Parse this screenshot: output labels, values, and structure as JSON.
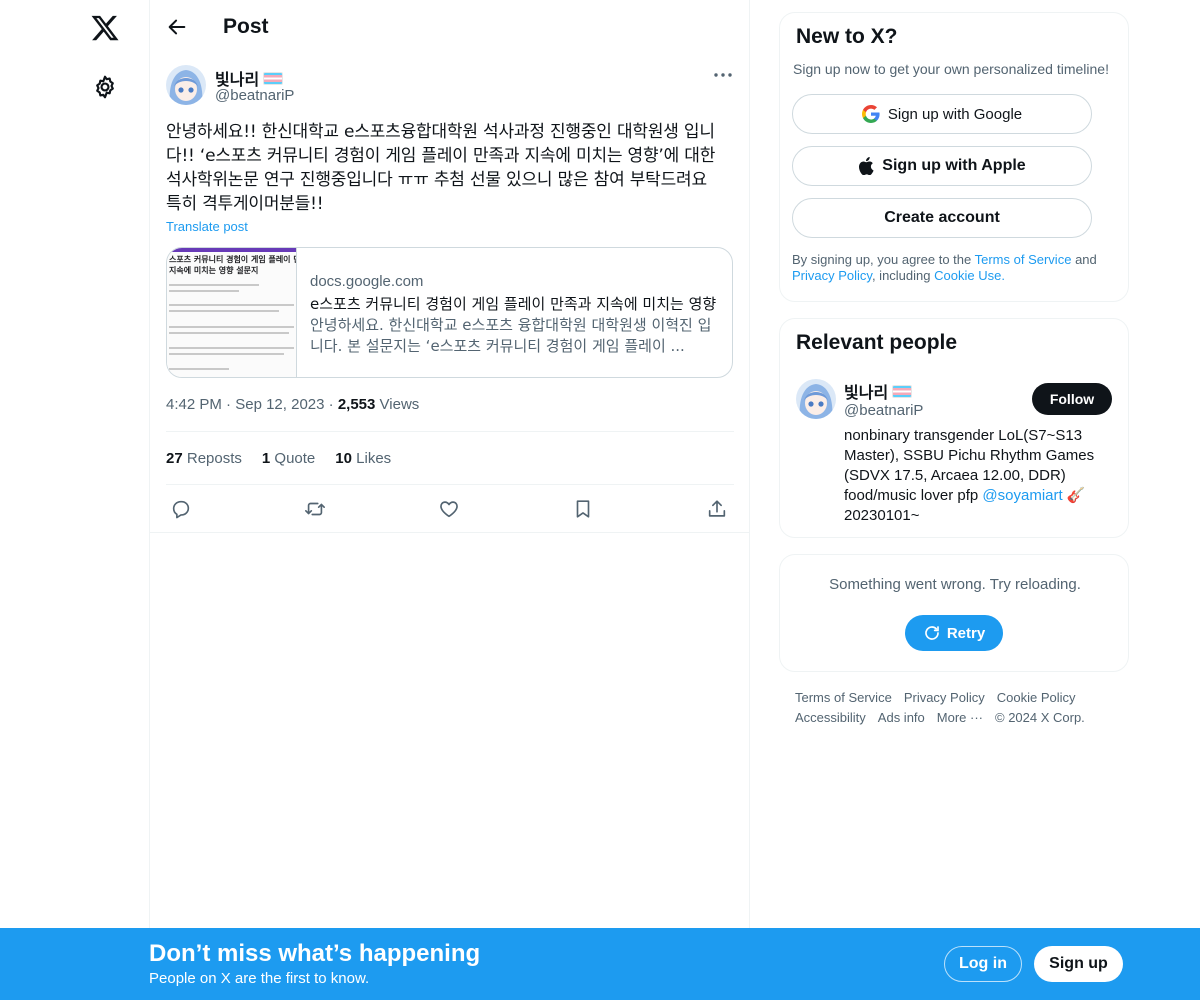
{
  "icons": {
    "logo": "x-logo-icon",
    "settings": "gear-icon",
    "back": "back-arrow-icon",
    "more": "more-horizontal-icon",
    "reply": "reply-icon",
    "repost": "repost-icon",
    "like": "heart-icon",
    "bookmark": "bookmark-icon",
    "share": "share-icon",
    "google": "google-icon",
    "apple": "apple-icon",
    "retry": "refresh-icon"
  },
  "colors": {
    "accent": "#1d9bf0",
    "text": "#0f1419",
    "muted": "#536471",
    "border": "#eff3f4"
  },
  "header": {
    "title": "Post"
  },
  "post": {
    "author_name": "빛나리",
    "author_handle": "@beatnariP",
    "text": "안녕하세요!! 한신대학교 e스포츠융합대학원 석사과정 진행중인 대학원생 입니다!! ‘e스포츠 커뮤니티 경험이 게임 플레이 만족과 지속에 미치는 영향’에 대한 석사학위논문 연구 진행중입니다 ㅠㅠ 추첨 선물 있으니 많은 참여 부탁드려요 특히 격투게이머분들!!",
    "translate_label": "Translate post",
    "card": {
      "thumb_title": "스포츠 커뮤니티 경험이 게임 플레이 만과 지속에 미치는 영향 설문지",
      "domain": "docs.google.com",
      "title": "e스포츠 커뮤니티 경험이 게임 플레이 만족과 지속에 미치는 영향",
      "description": "안녕하세요. 한신대학교 e스포츠 융합대학원 대학원생 이혁진 입니다. 본 설문지는 ‘e스포츠 커뮤니티 경험이 게임 플레이 ..."
    },
    "time": "4:42 PM",
    "date": "Sep 12, 2023",
    "views_count": "2,553",
    "views_label": "Views",
    "reposts_count": "27",
    "reposts_label": "Reposts",
    "quotes_count": "1",
    "quotes_label": "Quote",
    "likes_count": "10",
    "likes_label": "Likes"
  },
  "signup_box": {
    "title": "New to X?",
    "subtitle": "Sign up now to get your own personalized timeline!",
    "google_label": "Sign up with Google",
    "apple_label": "Sign up with Apple",
    "create_label": "Create account",
    "legal_prefix": "By signing up, you agree to the",
    "terms_link": "Terms of Service",
    "legal_and": "and",
    "privacy_link": "Privacy Policy",
    "legal_including": ", including",
    "cookie_link": "Cookie Use."
  },
  "relevant": {
    "title": "Relevant people",
    "name": "빛나리",
    "handle": "@beatnariP",
    "follow_label": "Follow",
    "bio_text": "nonbinary transgender LoL(S7~S13 Master), SSBU Pichu Rhythm Games (SDVX 17.5, Arcaea 12.00, DDR) food/music lover pfp",
    "bio_link": "@soyamiart",
    "bio_emoji": "🎸",
    "bio_suffix": "20230101~"
  },
  "error_box": {
    "message": "Something went wrong. Try reloading.",
    "retry_label": "Retry"
  },
  "footer": {
    "links": [
      "Terms of Service",
      "Privacy Policy",
      "Cookie Policy",
      "Accessibility",
      "Ads info",
      "More ···",
      "© 2024 X Corp."
    ]
  },
  "banner": {
    "title": "Don’t miss what’s happening",
    "subtitle": "People on X are the first to know.",
    "login_label": "Log in",
    "signup_label": "Sign up"
  }
}
